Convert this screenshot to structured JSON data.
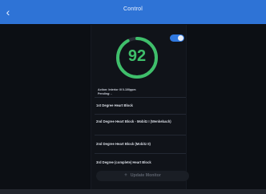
{
  "header": {
    "title": "Control",
    "back_glyph": "‹",
    "color": "#2e73d6"
  },
  "toggle": {
    "state": "on",
    "color": "#2f78e0"
  },
  "gauge": {
    "value": "92",
    "color": "#3fbf6b",
    "track_color": "#2a2f37"
  },
  "status": {
    "action": "Action: Interior III 0-100ppm",
    "pending": "Pending: -"
  },
  "options": [
    {
      "label": "1st Degree Heart Block"
    },
    {
      "label": "2nd Degree Heart Block - Mobitz I (Wenkebach)"
    },
    {
      "label": "2nd Degree Heart Block (Mobitz II)"
    },
    {
      "label": "3rd Degree (complete) Heart Block"
    }
  ],
  "update_button": {
    "label": "Update Monitor",
    "icon": "plus-icon",
    "state": "disabled"
  }
}
